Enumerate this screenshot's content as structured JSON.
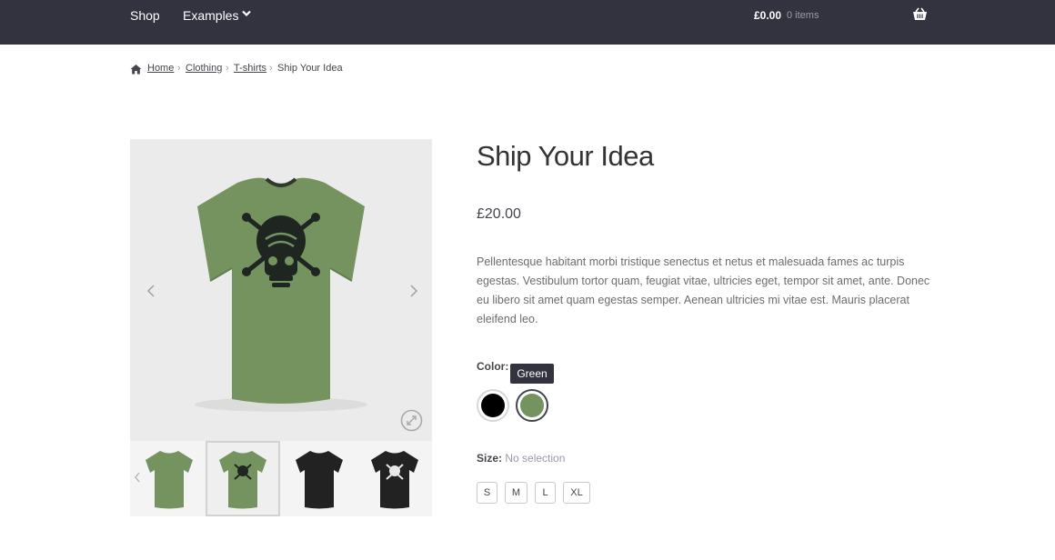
{
  "header": {
    "nav": {
      "shop": "Shop",
      "examples": "Examples"
    },
    "cart": {
      "amount": "£0.00",
      "count": "0 items"
    }
  },
  "breadcrumb": {
    "items": [
      "Home",
      "Clothing",
      "T-shirts"
    ],
    "current": "Ship Your Idea",
    "separator": "›"
  },
  "product": {
    "title": "Ship Your Idea",
    "price": "£20.00",
    "description": "Pellentesque habitant morbi tristique senectus et netus et malesuada fames ac turpis egestas. Vestibulum tortor quam, feugiat vitae, ultricies eget, tempor sit amet, ante. Donec eu libero sit amet quam egestas semper. Aenean ultricies mi vitae est. Mauris placerat eleifend leo.",
    "color": {
      "label": "Color:",
      "tooltip": "Green",
      "swatches": [
        {
          "name": "Black",
          "hex": "#000000"
        },
        {
          "name": "Green",
          "hex": "#74935f"
        }
      ]
    },
    "size": {
      "label": "Size:",
      "value": "No selection",
      "options": [
        "S",
        "M",
        "L",
        "XL"
      ]
    }
  },
  "gallery": {
    "shirt_colors": {
      "green": "#74935f",
      "black": "#222222"
    }
  }
}
